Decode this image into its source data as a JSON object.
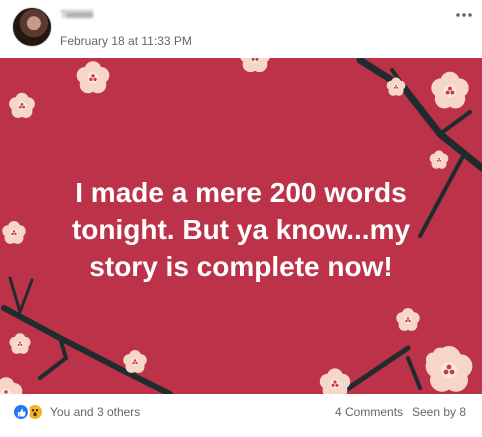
{
  "post": {
    "author_name": "Tiiiiiiiiiiiiiiiiiii",
    "timestamp": "February 18 at 11:33 PM",
    "more_icon": "more-horizontal-icon",
    "background_color": "#bc3349",
    "text": "I made a mere 200 words tonight. But ya know...my story is complete now!"
  },
  "reactions": {
    "icons": [
      "like-icon",
      "wow-icon"
    ],
    "summary": "You and 3 others"
  },
  "stats": {
    "comments": "4 Comments",
    "seen": "Seen by 8"
  },
  "colors": {
    "like": "#2078f4",
    "wow": "#f7b125",
    "blossom": "#f6d6c8",
    "branch": "#1f2b2c"
  }
}
